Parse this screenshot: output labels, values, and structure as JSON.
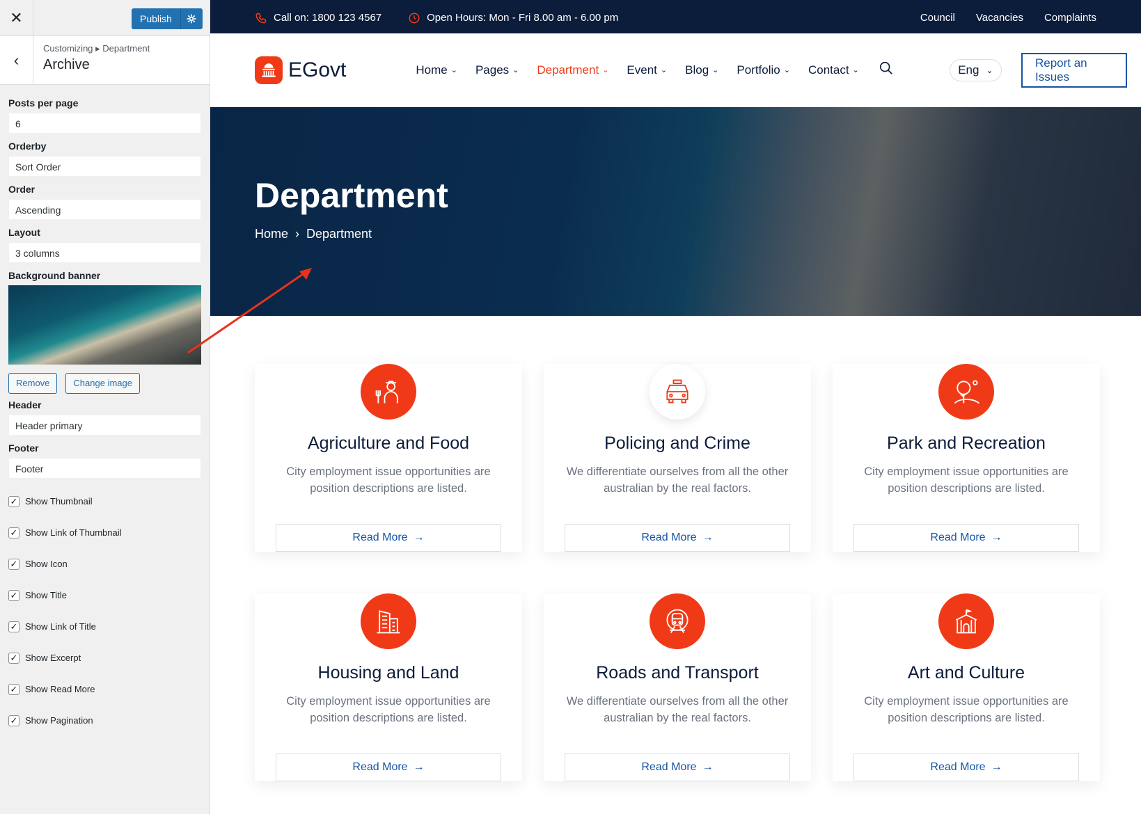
{
  "customizer": {
    "close_icon": "close-icon",
    "publish_label": "Publish",
    "crumb": "Customizing ▸ Department",
    "section_title": "Archive",
    "fields": [
      {
        "label": "Posts per page",
        "value": "6"
      },
      {
        "label": "Orderby",
        "value": "Sort Order"
      },
      {
        "label": "Order",
        "value": "Ascending"
      },
      {
        "label": "Layout",
        "value": "3 columns"
      }
    ],
    "banner_label": "Background banner",
    "remove_label": "Remove",
    "change_label": "Change image",
    "header_label": "Header",
    "header_value": "Header primary",
    "footer_label": "Footer",
    "footer_value": "Footer",
    "checks": [
      "Show Thumbnail",
      "Show Link of Thumbnail",
      "Show Icon",
      "Show Title",
      "Show Link of Title",
      "Show Excerpt",
      "Show Read More",
      "Show Pagination"
    ]
  },
  "topbar": {
    "call": "Call on: 1800 123 4567",
    "hours": "Open Hours: Mon - Fri 8.00 am - 6.00 pm",
    "links": [
      "Council",
      "Vacancies",
      "Complaints"
    ]
  },
  "nav": {
    "logo": "EGovt",
    "menu": [
      "Home",
      "Pages",
      "Department",
      "Event",
      "Blog",
      "Portfolio",
      "Contact"
    ],
    "active": "Department",
    "lang": "Eng",
    "report": "Report an Issues"
  },
  "hero": {
    "title": "Department",
    "crumbs": [
      "Home",
      "Department"
    ]
  },
  "cards": [
    {
      "title": "Agriculture and Food",
      "text": "City employment issue opportunities are position descriptions are listed.",
      "icon": "farmer-icon",
      "btn": "Read More"
    },
    {
      "title": "Policing and Crime",
      "text": "We differentiate ourselves from all the other australian by the real factors.",
      "icon": "police-car-icon",
      "btn": "Read More"
    },
    {
      "title": "Park and Recreation",
      "text": "City employment issue opportunities are position descriptions are listed.",
      "icon": "park-tree-icon",
      "btn": "Read More"
    },
    {
      "title": "Housing and Land",
      "text": "City employment issue opportunities are position descriptions are listed.",
      "icon": "buildings-icon",
      "btn": "Read More"
    },
    {
      "title": "Roads and Transport",
      "text": "We differentiate ourselves from all the other australian by the real factors.",
      "icon": "train-icon",
      "btn": "Read More"
    },
    {
      "title": "Art and Culture",
      "text": "City employment issue opportunities are position descriptions are listed.",
      "icon": "tent-icon",
      "btn": "Read More"
    }
  ],
  "colors": {
    "accent": "#f03a17",
    "navy": "#0c1c3b",
    "link": "#1554a3",
    "wp_blue": "#2271b1"
  }
}
